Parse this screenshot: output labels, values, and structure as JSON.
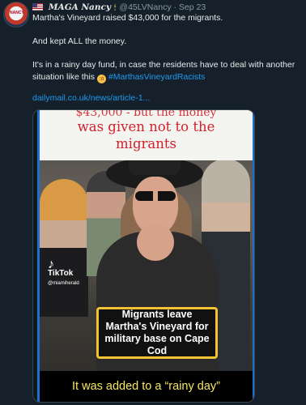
{
  "tweet": {
    "display_name": "MAGA Nancy",
    "handle": "@45LVNancy",
    "separator": "·",
    "date": "Sep 23",
    "avatar_text": "NANCY",
    "line1": "Martha's Vineyard raised $43,000 for the migrants.",
    "line2": "And kept ALL the money.",
    "line3": "It's in a rainy day fund, in case the residents have to deal with another situation like this",
    "hashtag": "#MarthasVineyardRacists",
    "link": "dailymail.co.uk/news/article-1..."
  },
  "media": {
    "top_cut_text": "$43,000 - but the money",
    "top_text_line1": "was given not to the",
    "top_text_line2": "migrants",
    "watermark_brand": "TikTok",
    "watermark_user": "@miamiherald",
    "caption": "Migrants leave Martha's Vineyard for military base on Cape Cod",
    "bottom_caption": "It was added to a “rainy day”"
  },
  "icons": {
    "flag": "us-flag-icon",
    "badge": "candle-icon",
    "emoji": "flushed-face-icon"
  }
}
